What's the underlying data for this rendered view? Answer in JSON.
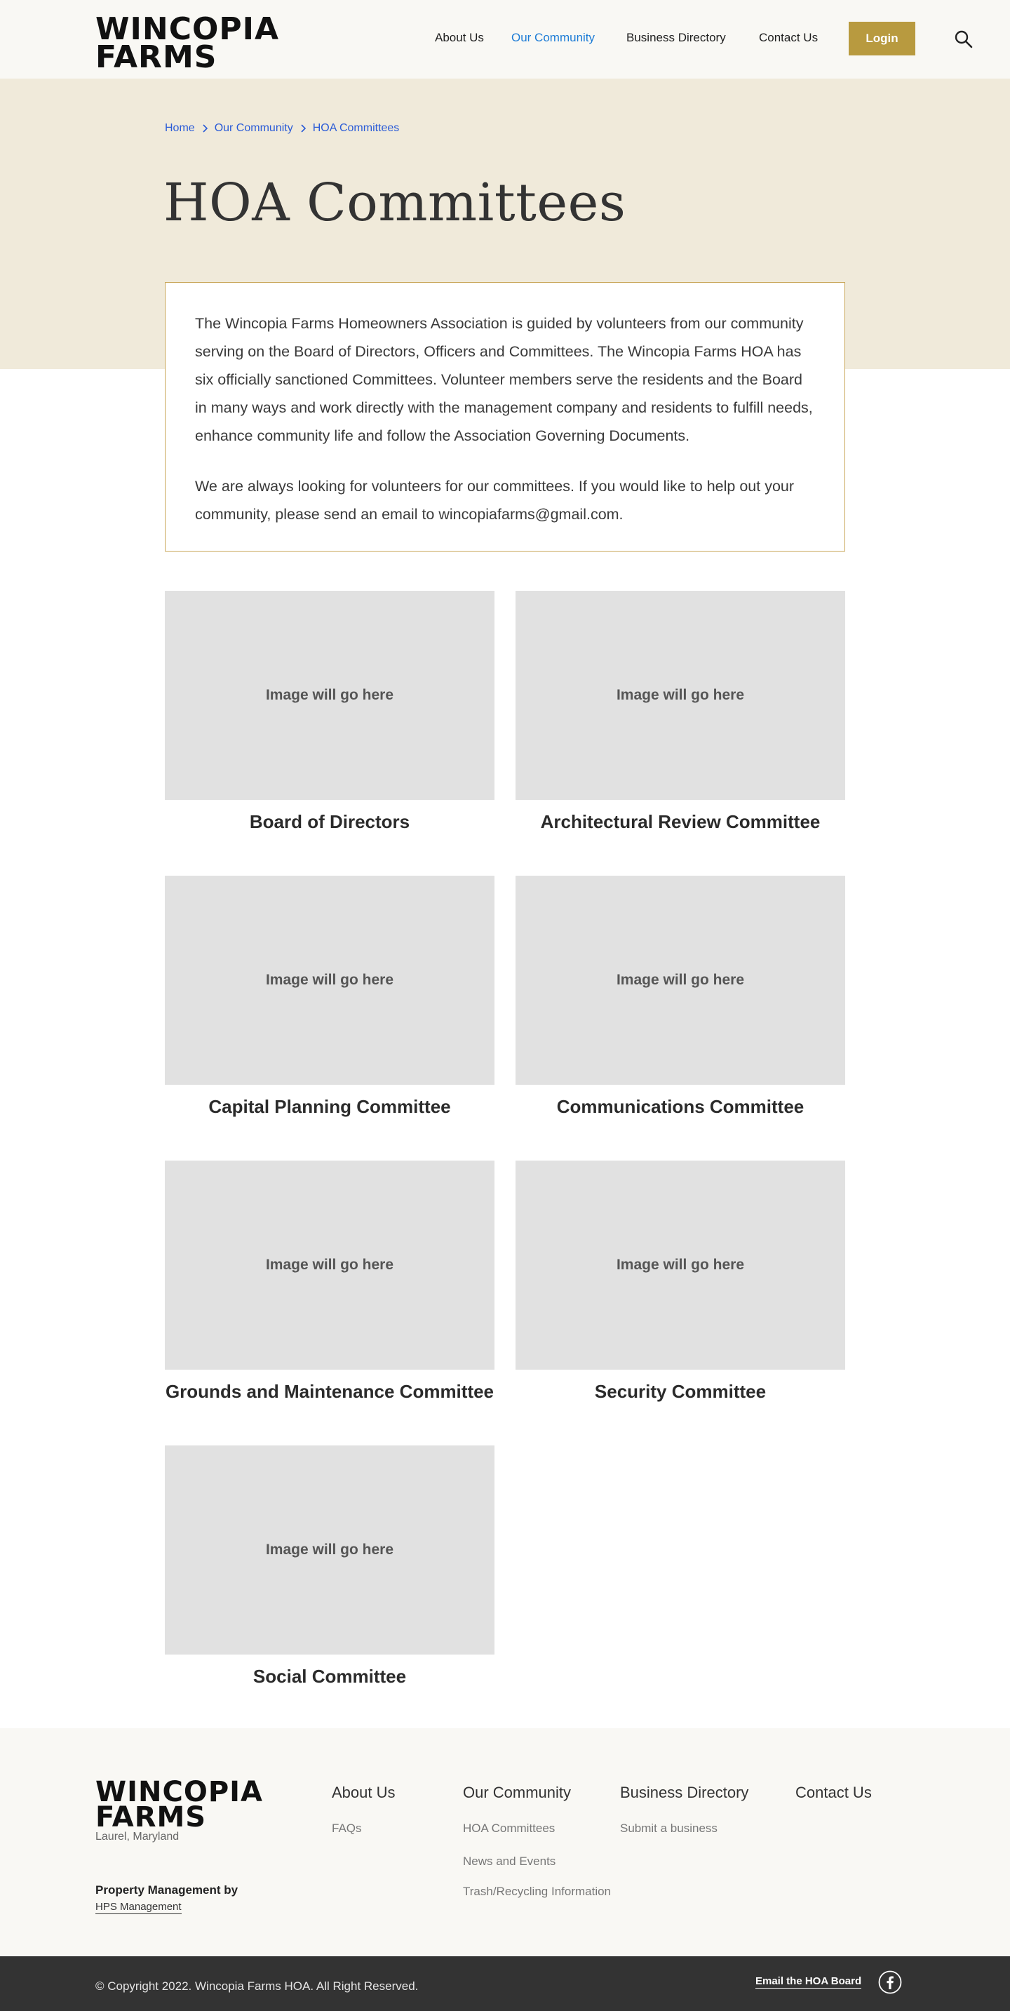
{
  "header": {
    "logo_line1": "WINCOPIA",
    "logo_line2": "FARMS",
    "nav": [
      {
        "label": "About Us"
      },
      {
        "label": "Our Community"
      },
      {
        "label": "Business Directory"
      },
      {
        "label": "Contact Us"
      }
    ],
    "active_nav": "Our Community",
    "login_label": "Login",
    "search_icon": "search-icon"
  },
  "breadcrumb": [
    {
      "label": "Home"
    },
    {
      "label": "Our Community"
    },
    {
      "label": "HOA Committees"
    }
  ],
  "page_title": "HOA Committees",
  "intro": {
    "paragraph1": "The Wincopia Farms Homeowners Association is guided by volunteers from our community serving on the Board of Directors, Officers and Committees. The Wincopia Farms HOA has six officially sanctioned Committees. Volunteer members serve the residents and the Board in many ways and work directly with the management company and residents to fulfill needs, enhance community life and follow the Association Governing Documents.",
    "paragraph2": "We are always looking for volunteers for our committees. If you would like to help out your community, please send an email to wincopiafarms@gmail.com."
  },
  "committees": [
    {
      "image_text": "Image will go here",
      "title": "Board of Directors"
    },
    {
      "image_text": "Image will go here",
      "title": "Architectural Review Committee"
    },
    {
      "image_text": "Image will go here",
      "title": "Capital Planning Committee"
    },
    {
      "image_text": "Image will go here",
      "title": "Communications Committee"
    },
    {
      "image_text": "Image will go here",
      "title": "Grounds and Maintenance Committee"
    },
    {
      "image_text": "Image will go here",
      "title": "Security Committee"
    },
    {
      "image_text": "Image will go here",
      "title": "Social Committee"
    }
  ],
  "footer": {
    "logo_line1": "WINCOPIA",
    "logo_line2": "FARMS",
    "location": "Laurel, Maryland",
    "pm_label": "Property Management by",
    "pm_link": "HPS Management",
    "columns": [
      {
        "heading": "About Us",
        "links": [
          "FAQs"
        ]
      },
      {
        "heading": "Our Community",
        "links": [
          "HOA Committees",
          "News and Events",
          "Trash/Recycling Information"
        ]
      },
      {
        "heading": "Business Directory",
        "links": [
          "Submit a business"
        ]
      },
      {
        "heading": "Contact Us",
        "links": []
      }
    ],
    "copyright": "© Copyright 2022. Wincopia Farms HOA. All Right Reserved.",
    "email_board": "Email the HOA Board",
    "social_icon": "facebook-icon"
  },
  "colors": {
    "accent_gold": "#b89a3f",
    "active_link": "#1d7cd6",
    "hero_bg": "#f0eada",
    "placeholder_bg": "#e1e1e1",
    "bottom_bar": "#333333"
  }
}
